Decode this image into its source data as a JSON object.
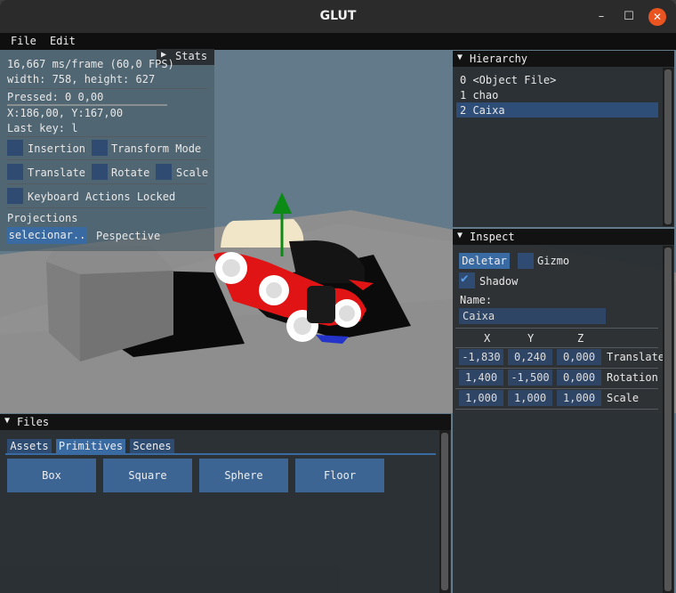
{
  "window": {
    "title": "GLUT",
    "minimize": "–",
    "maximize": "☐",
    "close": "✕"
  },
  "menu": {
    "file": "File",
    "edit": "Edit"
  },
  "stats": {
    "title": "Stats",
    "frame": "16,667 ms/frame (60,0 FPS)",
    "size": "width: 758, height: 627",
    "pressed": "Pressed: 0 0,00",
    "mouse": "X:186,00, Y:167,00",
    "last_key": "Last key: l",
    "insertion": "Insertion",
    "transform_mode": "Transform Mode",
    "translate": "Translate",
    "rotate": "Rotate",
    "scale": "Scale",
    "keyboard_locked": "Keyboard Actions Locked",
    "projections": "Projections",
    "select_button": "selecionar..",
    "perspective": "Pespective"
  },
  "hierarchy": {
    "title": "Hierarchy",
    "items": [
      "0 <Object File>",
      "1 chao",
      "2 Caixa"
    ],
    "selected_index": 2
  },
  "inspect": {
    "title": "Inspect",
    "delete_button": "Deletar",
    "gizmo": "Gizmo",
    "shadow": "Shadow",
    "name_label": "Name:",
    "name_value": "Caixa",
    "col_x": "X",
    "col_y": "Y",
    "col_z": "Z",
    "rows": [
      {
        "label": "Translate",
        "x": "-1,830",
        "y": "0,240",
        "z": "0,000"
      },
      {
        "label": "Rotation",
        "x": "1,400",
        "y": "-1,500",
        "z": "0,000"
      },
      {
        "label": "Scale",
        "x": "1,000",
        "y": "1,000",
        "z": "1,000"
      }
    ]
  },
  "files": {
    "title": "Files",
    "tabs": [
      "Assets",
      "Primitives",
      "Scenes"
    ],
    "active_tab": "Primitives",
    "primitives": [
      "Box",
      "Square",
      "Sphere",
      "Floor"
    ]
  },
  "colors": {
    "sky": "#627a89",
    "floor": "#8c8c8c",
    "car_body": "#e01414",
    "gizmo": "#0c8a16",
    "accent": "#3a6aa2"
  }
}
